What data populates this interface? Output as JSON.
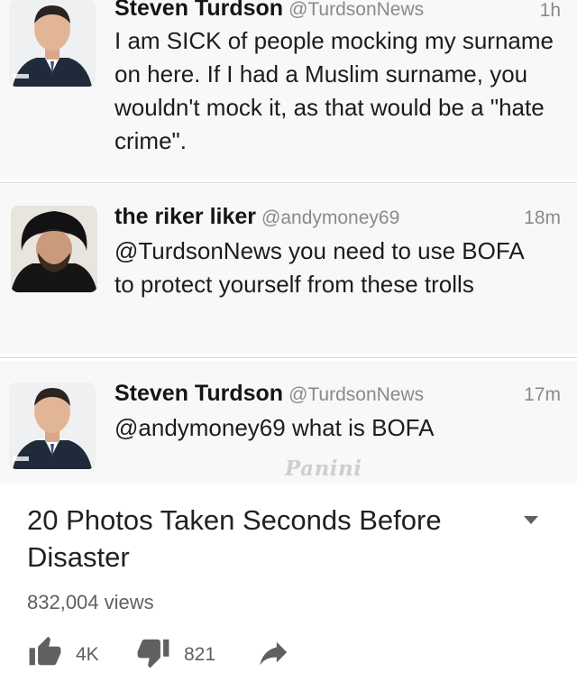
{
  "tweets": [
    {
      "name": "Steven Turdson",
      "handle": "@TurdsonNews",
      "time": "1h",
      "text": "I am SICK of people mocking my surname on here. If I had a Muslim surname, you wouldn't mock it, as that would be a \"hate crime\"."
    },
    {
      "name": "the riker liker",
      "handle": "@andymoney69",
      "time": "18m",
      "text": "@TurdsonNews you need to use BOFA to protect yourself from these trolls"
    },
    {
      "name": "Steven Turdson",
      "handle": "@TurdsonNews",
      "time": "17m",
      "text": "@andymoney69 what is BOFA"
    }
  ],
  "watermark": "Panini",
  "video": {
    "title": "20 Photos Taken Seconds Before Disaster",
    "views": "832,004 views",
    "likes": "4K",
    "dislikes": "821"
  },
  "icons": [
    "chevron-down-icon",
    "thumbs-up-icon",
    "thumbs-down-icon",
    "share-icon"
  ]
}
